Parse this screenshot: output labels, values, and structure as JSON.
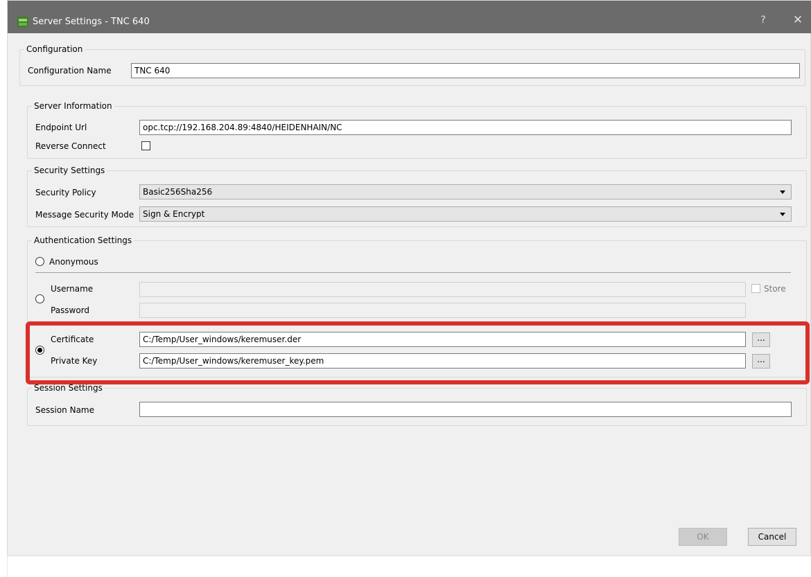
{
  "window": {
    "title": "Server Settings - TNC 640",
    "help_label": "?",
    "close_label": "✕"
  },
  "configuration": {
    "group_title": "Configuration",
    "name_label": "Configuration Name",
    "name_value": "TNC 640"
  },
  "server_info": {
    "group_title": "Server Information",
    "endpoint_label": "Endpoint Url",
    "endpoint_value": "opc.tcp://192.168.204.89:4840/HEIDENHAIN/NC",
    "reverse_label": "Reverse Connect",
    "reverse_checked": false
  },
  "security": {
    "group_title": "Security Settings",
    "policy_label": "Security Policy",
    "policy_value": "Basic256Sha256",
    "mode_label": "Message Security Mode",
    "mode_value": "Sign & Encrypt"
  },
  "auth": {
    "group_title": "Authentication Settings",
    "anonymous_label": "Anonymous",
    "username_label": "Username",
    "username_value": "",
    "password_label": "Password",
    "password_value": "",
    "store_label": "Store",
    "certificate_label": "Certificate",
    "certificate_value": "C:/Temp/User_windows/keremuser.der",
    "private_key_label": "Private Key",
    "private_key_value": "C:/Temp/User_windows/keremuser_key.pem",
    "browse_label": "...",
    "selected": "certificate"
  },
  "session": {
    "group_title": "Session Settings",
    "name_label": "Session Name",
    "name_value": ""
  },
  "footer": {
    "ok_label": "OK",
    "cancel_label": "Cancel"
  },
  "colors": {
    "titlebar": "#6b6b6b",
    "highlight": "#d9302a",
    "dialog_bg": "#f0f0f0"
  }
}
